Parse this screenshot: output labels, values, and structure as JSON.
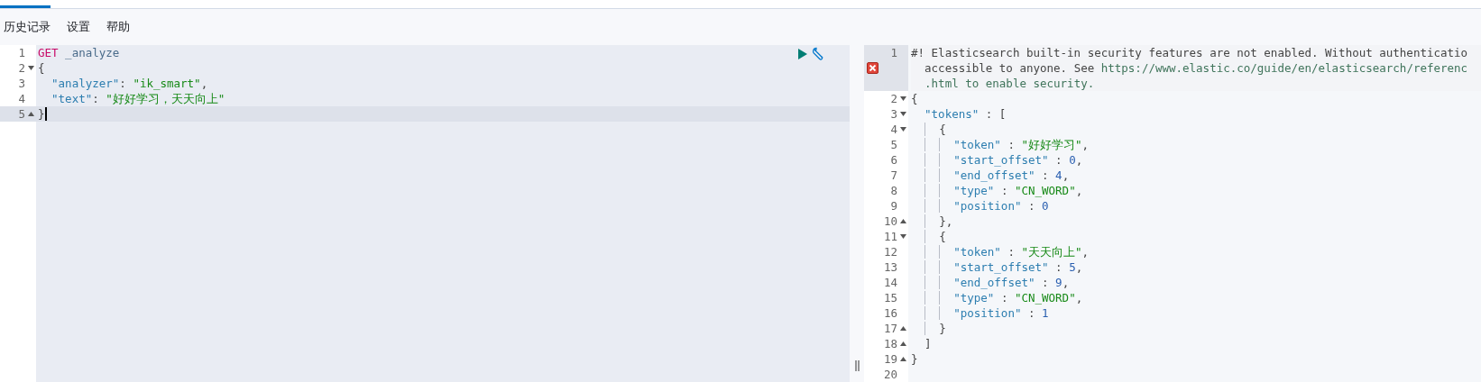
{
  "tabs": [
    {
      "selected": true
    }
  ],
  "menu": [
    "历史记录",
    "设置",
    "帮助"
  ],
  "request_editor": {
    "lines": [
      {
        "number": "1",
        "fold_start": false,
        "fold_end": false,
        "selected": false,
        "segments": [
          {
            "kind": "method",
            "text": "GET"
          },
          {
            "kind": "path",
            "text": " _analyze"
          }
        ]
      },
      {
        "number": "2",
        "fold_start": true,
        "fold_end": false,
        "selected": false,
        "segments": [
          {
            "kind": "punct",
            "text": "{"
          }
        ]
      },
      {
        "number": "3",
        "fold_start": false,
        "fold_end": false,
        "selected": false,
        "segments": [
          {
            "kind": "key",
            "text": "  \"analyzer\""
          },
          {
            "kind": "punct",
            "text": ": "
          },
          {
            "kind": "string",
            "text": "\"ik_smart\""
          },
          {
            "kind": "punct",
            "text": ","
          }
        ]
      },
      {
        "number": "4",
        "fold_start": false,
        "fold_end": false,
        "selected": false,
        "segments": [
          {
            "kind": "key",
            "text": "  \"text\""
          },
          {
            "kind": "punct",
            "text": ": "
          },
          {
            "kind": "string",
            "text": "\"好好学习，天天向上\""
          }
        ]
      },
      {
        "number": "5",
        "fold_start": false,
        "fold_end": true,
        "selected": true,
        "segments": [
          {
            "kind": "punct",
            "text": "}"
          }
        ]
      }
    ]
  },
  "response_editor": {
    "lines": [
      {
        "number": "1",
        "fold_start": false,
        "fold_end": false,
        "error": true,
        "segments": [
          {
            "kind": "comment",
            "text": "#! Elasticsearch built-in security features are not enabled. Without authenticatio"
          }
        ],
        "wrapped": [
          [
            {
              "kind": "comment",
              "text": "  accessible to anyone. See "
            },
            {
              "kind": "link",
              "text": "https://www.elastic.co/guide/en/elasticsearch/referenc"
            }
          ],
          [
            {
              "kind": "link",
              "text": "  .html to enable security."
            }
          ]
        ]
      },
      {
        "number": "2",
        "fold_start": true,
        "fold_end": false,
        "error": false,
        "segments": [
          {
            "kind": "punct",
            "text": "{"
          }
        ]
      },
      {
        "number": "3",
        "fold_start": true,
        "fold_end": false,
        "error": false,
        "segments": [
          {
            "kind": "key",
            "text": "  \"tokens\""
          },
          {
            "kind": "punct",
            "text": " : ["
          }
        ]
      },
      {
        "number": "4",
        "fold_start": true,
        "fold_end": false,
        "error": false,
        "segments": [
          {
            "kind": "punct",
            "text": "    {"
          }
        ]
      },
      {
        "number": "5",
        "fold_start": false,
        "fold_end": false,
        "error": false,
        "segments": [
          {
            "kind": "key",
            "text": "      \"token\""
          },
          {
            "kind": "punct",
            "text": " : "
          },
          {
            "kind": "string",
            "text": "\"好好学习\""
          },
          {
            "kind": "punct",
            "text": ","
          }
        ]
      },
      {
        "number": "6",
        "fold_start": false,
        "fold_end": false,
        "error": false,
        "segments": [
          {
            "kind": "key",
            "text": "      \"start_offset\""
          },
          {
            "kind": "punct",
            "text": " : "
          },
          {
            "kind": "number",
            "text": "0"
          },
          {
            "kind": "punct",
            "text": ","
          }
        ]
      },
      {
        "number": "7",
        "fold_start": false,
        "fold_end": false,
        "error": false,
        "segments": [
          {
            "kind": "key",
            "text": "      \"end_offset\""
          },
          {
            "kind": "punct",
            "text": " : "
          },
          {
            "kind": "number",
            "text": "4"
          },
          {
            "kind": "punct",
            "text": ","
          }
        ]
      },
      {
        "number": "8",
        "fold_start": false,
        "fold_end": false,
        "error": false,
        "segments": [
          {
            "kind": "key",
            "text": "      \"type\""
          },
          {
            "kind": "punct",
            "text": " : "
          },
          {
            "kind": "string",
            "text": "\"CN_WORD\""
          },
          {
            "kind": "punct",
            "text": ","
          }
        ]
      },
      {
        "number": "9",
        "fold_start": false,
        "fold_end": false,
        "error": false,
        "segments": [
          {
            "kind": "key",
            "text": "      \"position\""
          },
          {
            "kind": "punct",
            "text": " : "
          },
          {
            "kind": "number",
            "text": "0"
          }
        ]
      },
      {
        "number": "10",
        "fold_start": false,
        "fold_end": true,
        "error": false,
        "segments": [
          {
            "kind": "punct",
            "text": "    },"
          }
        ]
      },
      {
        "number": "11",
        "fold_start": true,
        "fold_end": false,
        "error": false,
        "segments": [
          {
            "kind": "punct",
            "text": "    {"
          }
        ]
      },
      {
        "number": "12",
        "fold_start": false,
        "fold_end": false,
        "error": false,
        "segments": [
          {
            "kind": "key",
            "text": "      \"token\""
          },
          {
            "kind": "punct",
            "text": " : "
          },
          {
            "kind": "string",
            "text": "\"天天向上\""
          },
          {
            "kind": "punct",
            "text": ","
          }
        ]
      },
      {
        "number": "13",
        "fold_start": false,
        "fold_end": false,
        "error": false,
        "segments": [
          {
            "kind": "key",
            "text": "      \"start_offset\""
          },
          {
            "kind": "punct",
            "text": " : "
          },
          {
            "kind": "number",
            "text": "5"
          },
          {
            "kind": "punct",
            "text": ","
          }
        ]
      },
      {
        "number": "14",
        "fold_start": false,
        "fold_end": false,
        "error": false,
        "segments": [
          {
            "kind": "key",
            "text": "      \"end_offset\""
          },
          {
            "kind": "punct",
            "text": " : "
          },
          {
            "kind": "number",
            "text": "9"
          },
          {
            "kind": "punct",
            "text": ","
          }
        ]
      },
      {
        "number": "15",
        "fold_start": false,
        "fold_end": false,
        "error": false,
        "segments": [
          {
            "kind": "key",
            "text": "      \"type\""
          },
          {
            "kind": "punct",
            "text": " : "
          },
          {
            "kind": "string",
            "text": "\"CN_WORD\""
          },
          {
            "kind": "punct",
            "text": ","
          }
        ]
      },
      {
        "number": "16",
        "fold_start": false,
        "fold_end": false,
        "error": false,
        "segments": [
          {
            "kind": "key",
            "text": "      \"position\""
          },
          {
            "kind": "punct",
            "text": " : "
          },
          {
            "kind": "number",
            "text": "1"
          }
        ]
      },
      {
        "number": "17",
        "fold_start": false,
        "fold_end": true,
        "error": false,
        "segments": [
          {
            "kind": "punct",
            "text": "    }"
          }
        ]
      },
      {
        "number": "18",
        "fold_start": false,
        "fold_end": true,
        "error": false,
        "segments": [
          {
            "kind": "punct",
            "text": "  ]"
          }
        ]
      },
      {
        "number": "19",
        "fold_start": false,
        "fold_end": true,
        "error": false,
        "segments": [
          {
            "kind": "punct",
            "text": "}"
          }
        ]
      },
      {
        "number": "20",
        "fold_start": false,
        "fold_end": false,
        "error": false
      }
    ]
  }
}
